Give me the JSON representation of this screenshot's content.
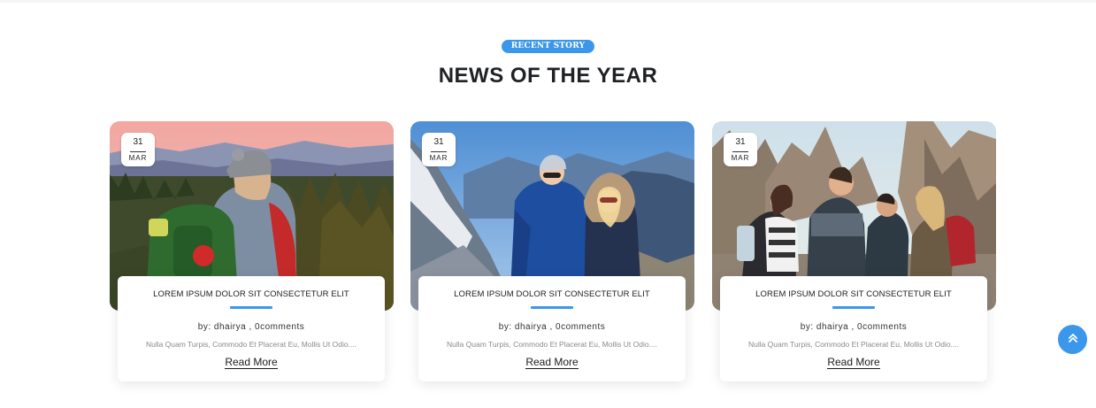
{
  "section": {
    "badge": "RECENT STORY",
    "title": "NEWS OF THE YEAR"
  },
  "cards": [
    {
      "image": "hiker-with-backpack-mountain-sunset",
      "date": {
        "day": "31",
        "month": "MAR"
      },
      "title": "LOREM IPSUM DOLOR SIT CONSECTETUR ELIT",
      "meta": "by: dhairya , 0comments",
      "excerpt": "Nulla Quam Turpis, Commodo Et Placerat Eu, Mollis Ut Odio....",
      "read_more": "Read More"
    },
    {
      "image": "couple-hikers-snowy-mountains",
      "date": {
        "day": "31",
        "month": "MAR"
      },
      "title": "LOREM IPSUM DOLOR SIT CONSECTETUR ELIT",
      "meta": "by: dhairya , 0comments",
      "excerpt": "Nulla Quam Turpis, Commodo Et Placerat Eu, Mollis Ut Odio....",
      "read_more": "Read More"
    },
    {
      "image": "group-of-hikers-rocky-peaks",
      "date": {
        "day": "31",
        "month": "MAR"
      },
      "title": "LOREM IPSUM DOLOR SIT CONSECTETUR ELIT",
      "meta": "by: dhairya , 0comments",
      "excerpt": "Nulla Quam Turpis, Commodo Et Placerat Eu, Mollis Ut Odio....",
      "read_more": "Read More"
    }
  ],
  "scroll_top_icon": "double-chevron-up-icon",
  "colors": {
    "accent": "#3b97ea",
    "title": "#1f2125",
    "excerpt": "#8a8a8a"
  }
}
